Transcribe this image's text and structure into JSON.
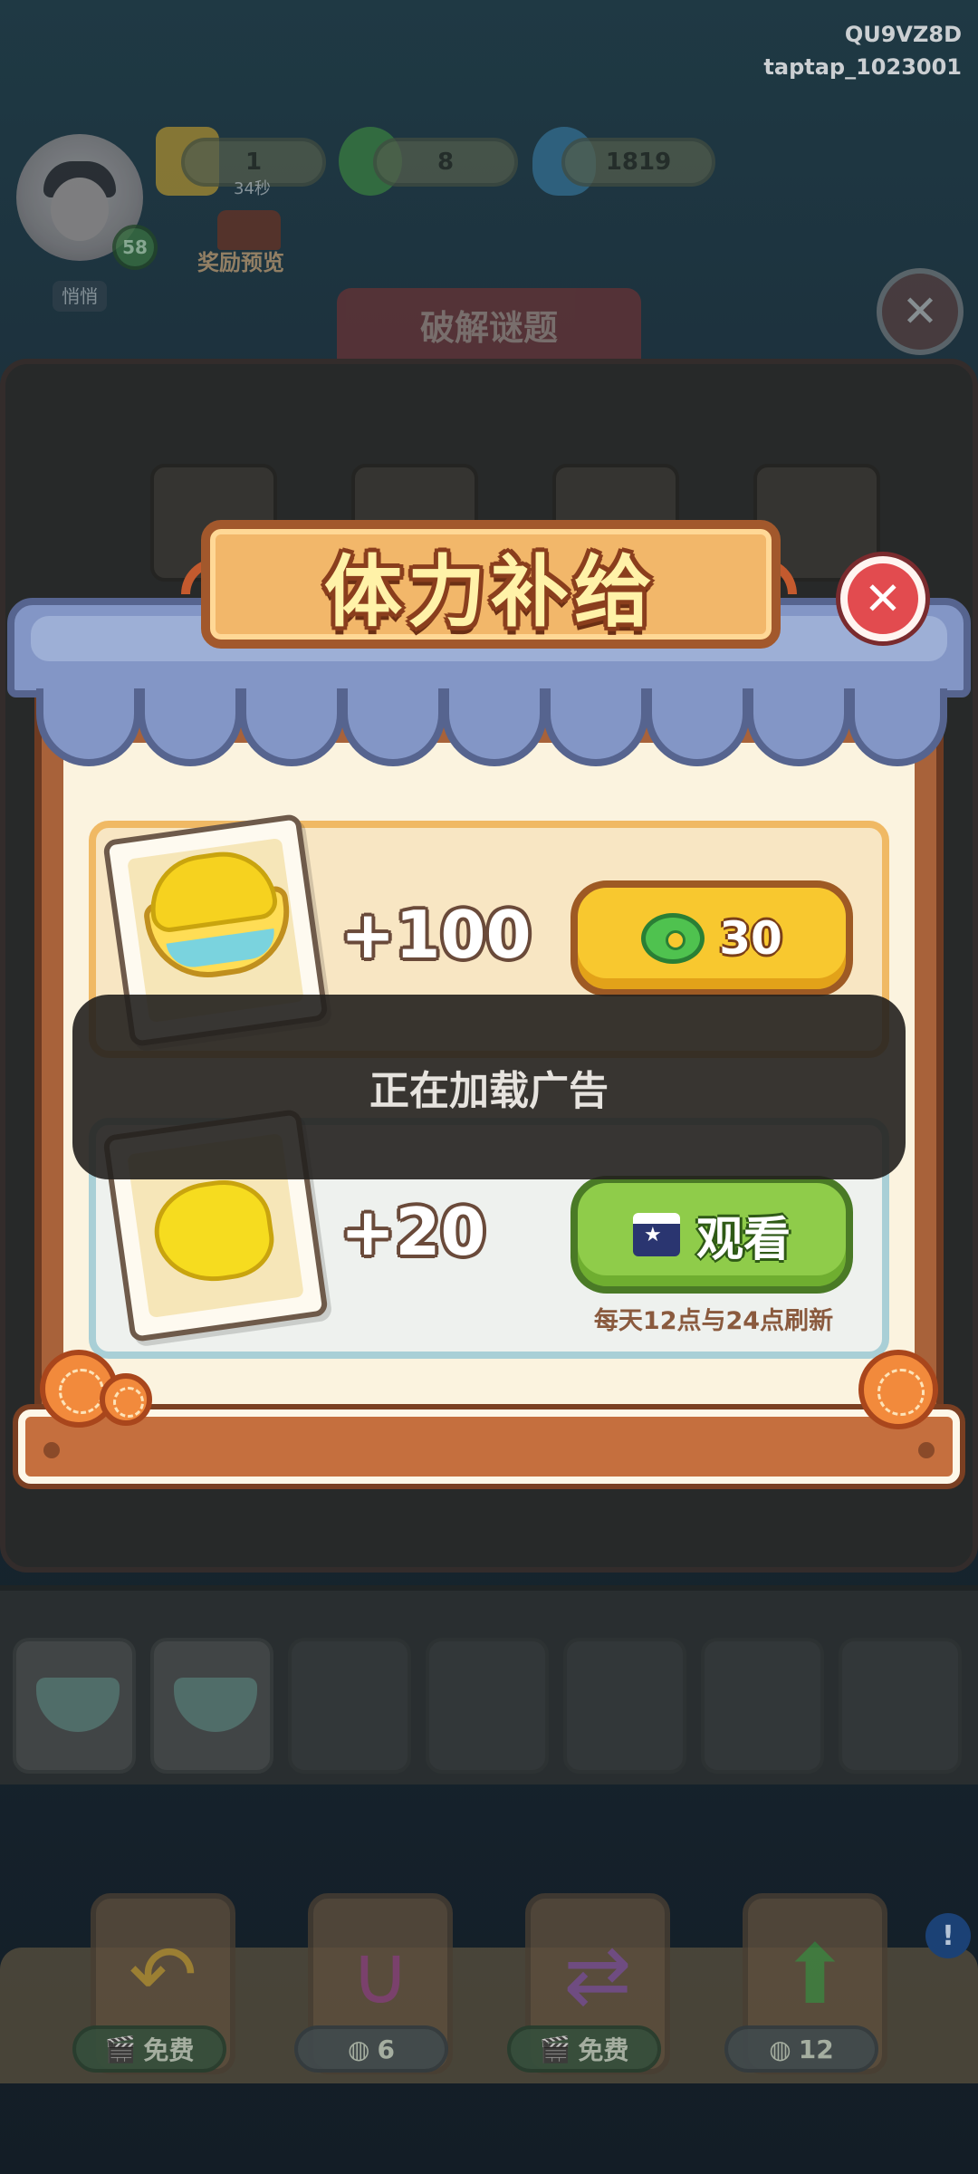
{
  "meta": {
    "code": "QU9VZ8D",
    "user": "taptap_1023001"
  },
  "hud": {
    "level": "58",
    "player_tag": "悄悄",
    "resources": [
      {
        "name": "stamina",
        "value": "1",
        "icon": "stamina-icon",
        "timer": "34秒"
      },
      {
        "name": "jade",
        "value": "8",
        "icon": "jade-coin-icon"
      },
      {
        "name": "flame",
        "value": "1819",
        "icon": "flame-icon"
      }
    ],
    "reward_preview": "奖励预览"
  },
  "game": {
    "tab_title": "破解谜题"
  },
  "modal": {
    "title": "体力补给",
    "offers": [
      {
        "amount": "+100",
        "price": "30",
        "price_icon": "jade-coin-icon",
        "item_icon": "gold-bowl-icon"
      },
      {
        "amount": "+20",
        "action": "观看",
        "action_icon": "clapperboard-icon",
        "note": "每天12点与24点刷新",
        "item_icon": "lemon-slice-icon"
      }
    ]
  },
  "toast": {
    "text": "正在加载广告"
  },
  "tools": [
    {
      "name": "undo",
      "icon": "undo-arrow-icon",
      "label": "免费",
      "label_icon": "clapperboard-icon"
    },
    {
      "name": "magnet",
      "icon": "magnet-icon",
      "label": "6",
      "label_icon": "jade-coin-icon"
    },
    {
      "name": "shuffle",
      "icon": "shuffle-icon",
      "label": "免费",
      "label_icon": "clapperboard-icon"
    },
    {
      "name": "up",
      "icon": "up-arrow-icon",
      "label": "12",
      "label_icon": "jade-coin-icon"
    }
  ],
  "colors": {
    "gold_button": "#f8c82f",
    "green_button": "#8fcc4a",
    "close_red": "#e24b4f",
    "awning_blue": "#8396c6"
  }
}
